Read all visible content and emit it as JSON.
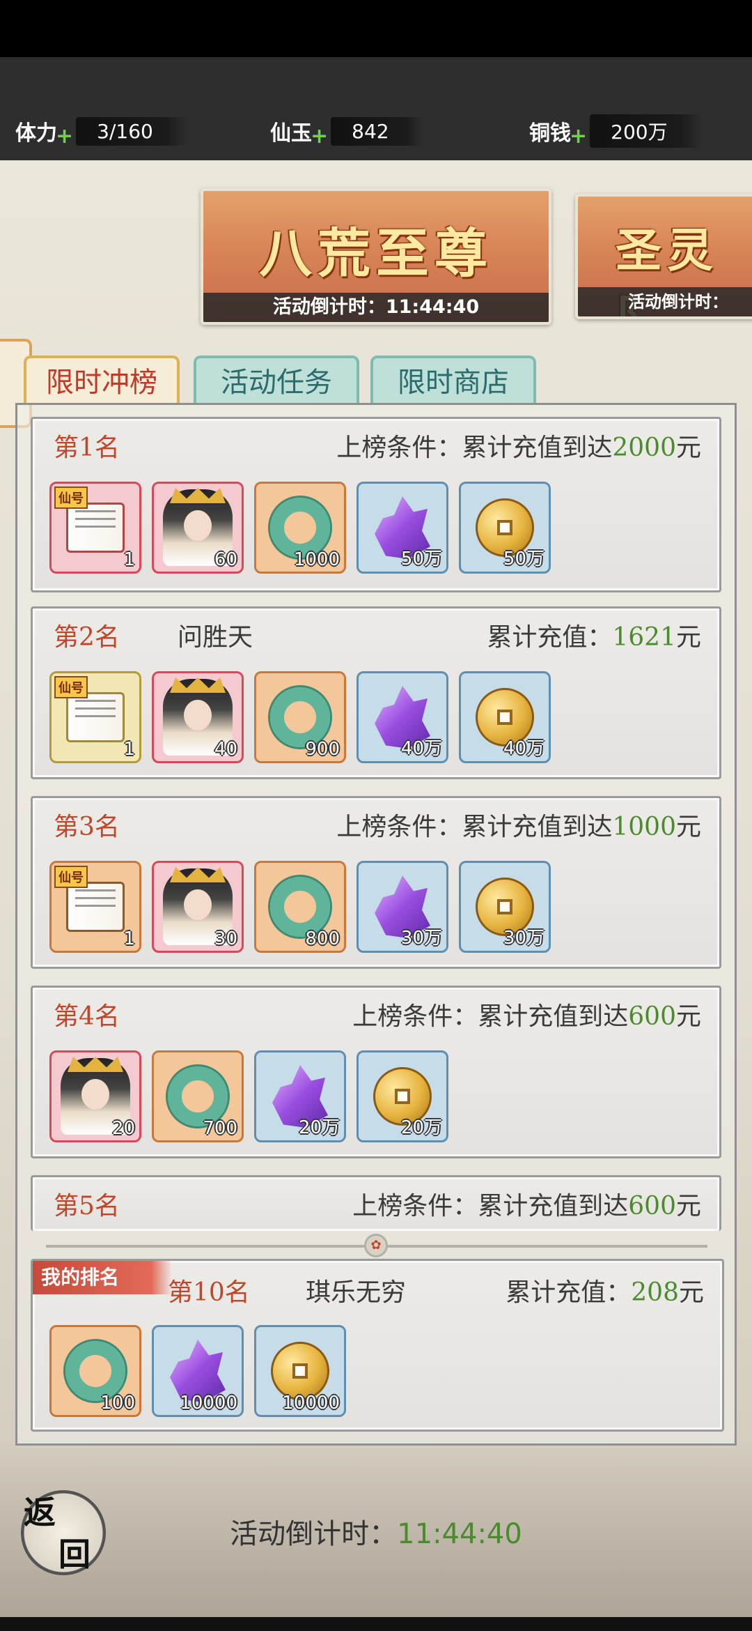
{
  "resources": [
    {
      "label": "体力",
      "value": "3/160"
    },
    {
      "label": "仙玉",
      "value": "842"
    },
    {
      "label": "铜钱",
      "value": "200万"
    }
  ],
  "banners": [
    {
      "title": "八荒至尊",
      "countdown": "活动倒计时：11:44:40"
    },
    {
      "title": "圣灵阝",
      "countdown": "活动倒计时："
    }
  ],
  "tabs": [
    "限时冲榜",
    "活动任务",
    "限时商店"
  ],
  "ranks": [
    {
      "rank": "第1名",
      "cond_label": "上榜条件：累计充值到达",
      "amount": "2000",
      "unit": "元",
      "items": [
        {
          "type": "scroll",
          "tag": "仙号",
          "count": "1"
        },
        {
          "type": "hero",
          "count": "60"
        },
        {
          "type": "jade",
          "count": "1000"
        },
        {
          "type": "crystal",
          "count": "50万"
        },
        {
          "type": "coin",
          "count": "50万"
        }
      ]
    },
    {
      "rank": "第2名",
      "name": "问胜天",
      "cond_label": "累计充值：",
      "amount": "1621",
      "unit": "元",
      "items": [
        {
          "type": "scroll",
          "tag": "仙号",
          "count": "1"
        },
        {
          "type": "hero",
          "count": "40"
        },
        {
          "type": "jade",
          "count": "900"
        },
        {
          "type": "crystal",
          "count": "40万"
        },
        {
          "type": "coin",
          "count": "40万"
        }
      ]
    },
    {
      "rank": "第3名",
      "cond_label": "上榜条件：累计充值到达",
      "amount": "1000",
      "unit": "元",
      "items": [
        {
          "type": "scroll",
          "tag": "仙号",
          "count": "1"
        },
        {
          "type": "hero",
          "count": "30"
        },
        {
          "type": "jade",
          "count": "800"
        },
        {
          "type": "crystal",
          "count": "30万"
        },
        {
          "type": "coin",
          "count": "30万"
        }
      ]
    },
    {
      "rank": "第4名",
      "cond_label": "上榜条件：累计充值到达",
      "amount": "600",
      "unit": "元",
      "items": [
        {
          "type": "hero",
          "count": "20"
        },
        {
          "type": "jade",
          "count": "700"
        },
        {
          "type": "crystal",
          "count": "20万"
        },
        {
          "type": "coin",
          "count": "20万"
        }
      ]
    },
    {
      "rank": "第5名",
      "cond_label": "上榜条件：累计充值到达",
      "amount": "600",
      "unit": "元"
    }
  ],
  "my_rank": {
    "ribbon": "我的排名",
    "rank": "第10名",
    "name": "琪乐无穷",
    "cond_label": "累计充值：",
    "amount": "208",
    "unit": "元",
    "items": [
      {
        "type": "jade",
        "count": "100"
      },
      {
        "type": "crystal",
        "count": "10000"
      },
      {
        "type": "coin",
        "count": "10000"
      }
    ]
  },
  "back_button": {
    "line1": "返",
    "line2": "回"
  },
  "bottom_countdown": {
    "label": "活动倒计时：",
    "time": "11:44:40"
  },
  "colors": {
    "rank_red": "#c0462a",
    "amount_green": "#4a8b2e",
    "tab_active_text": "#c0392b",
    "tab_inactive_text": "#2a6b6c"
  },
  "icons": {
    "plus": "plus-icon",
    "scroll": "scroll-icon",
    "hero": "hero-portrait-icon",
    "jade": "jade-ring-icon",
    "crystal": "purple-crystal-icon",
    "coin": "copper-coin-icon"
  }
}
